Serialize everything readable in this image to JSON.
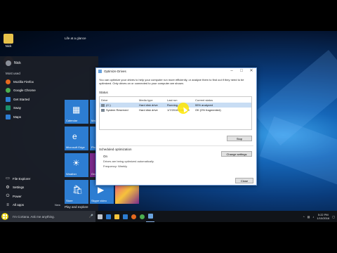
{
  "desktop": {
    "icons": [
      {
        "label": "Nick",
        "icon": "user-folder-icon"
      },
      {
        "label": "Mozilla Firefox",
        "icon": "firefox-icon"
      }
    ]
  },
  "start_menu": {
    "user": "Nick",
    "most_used_label": "Most used",
    "apps": [
      {
        "label": "Mozilla Firefox",
        "icon": "firefox-icon",
        "color": "#e66a1f"
      },
      {
        "label": "Google Chrome",
        "icon": "chrome-icon",
        "color": "#4caf50"
      },
      {
        "label": "Get Started",
        "icon": "lightbulb-icon",
        "color": "#2d7dd2"
      },
      {
        "label": "Sway",
        "icon": "sway-icon",
        "color": "#1a8f6a"
      },
      {
        "label": "Maps",
        "icon": "maps-icon",
        "color": "#2d7dd2"
      }
    ],
    "system": [
      {
        "label": "File Explorer",
        "glyph": "▭"
      },
      {
        "label": "Settings",
        "glyph": "⚙"
      },
      {
        "label": "Power",
        "glyph": "⏻"
      },
      {
        "label": "All apps",
        "glyph": "≡",
        "badge": "New"
      }
    ],
    "life_label": "Life at a glance",
    "play_label": "Play and explore",
    "tiles": [
      {
        "label": "Calendar",
        "glyph": "▦"
      },
      {
        "label": "Mail",
        "glyph": "✉"
      },
      {
        "label": "Microsoft Edge",
        "glyph": "e"
      },
      {
        "label": "Photos",
        "glyph": "▣"
      },
      {
        "label": "Weather",
        "glyph": "☀"
      },
      {
        "label": "OneNote",
        "glyph": "N"
      },
      {
        "label": "Store",
        "glyph": "🛍"
      },
      {
        "label": "Skype video",
        "glyph": "▶"
      },
      {
        "label": "",
        "glyph": ""
      }
    ]
  },
  "window": {
    "title": "Optimize Drives",
    "description": "You can optimize your drives to help your computer run more efficiently, or analyze them to find out if they need to be optimized. Only drives on or connected to your computer are shown.",
    "status_label": "Status",
    "columns": [
      "Drive",
      "Media type",
      "Last run",
      "Current status"
    ],
    "rows": [
      {
        "drive": "(C:)",
        "media": "Hard disk drive",
        "last_run": "Running...",
        "status": "55% analyzed",
        "selected": true
      },
      {
        "drive": "System Reserved",
        "media": "Hard disk drive",
        "last_run": "1/7/2016 5:06 PM",
        "status": "OK (0% fragmented)",
        "selected": false
      }
    ],
    "stop_button": "Stop",
    "scheduled_label": "Scheduled optimization",
    "schedule_state": "On",
    "schedule_info": "Drives are being optimized automatically.",
    "frequency": "Frequency: Weekly",
    "change_settings_button": "Change settings",
    "close_button": "Close"
  },
  "taskbar": {
    "search_placeholder": "I'm Cortana. Ask me anything.",
    "apps": [
      {
        "icon": "task-view-icon",
        "color": "#bfc5cc"
      },
      {
        "icon": "edge-icon",
        "color": "#2d7dd2"
      },
      {
        "icon": "file-explorer-icon",
        "color": "#f3c33b"
      },
      {
        "icon": "store-icon",
        "color": "#2d7dd2"
      },
      {
        "icon": "firefox-icon",
        "color": "#e66a1f"
      },
      {
        "icon": "chrome-icon",
        "color": "#4caf50"
      },
      {
        "icon": "optimize-drives-icon",
        "color": "#6aa3de"
      }
    ],
    "time": "5:22 PM",
    "date": "1/10/2016"
  }
}
